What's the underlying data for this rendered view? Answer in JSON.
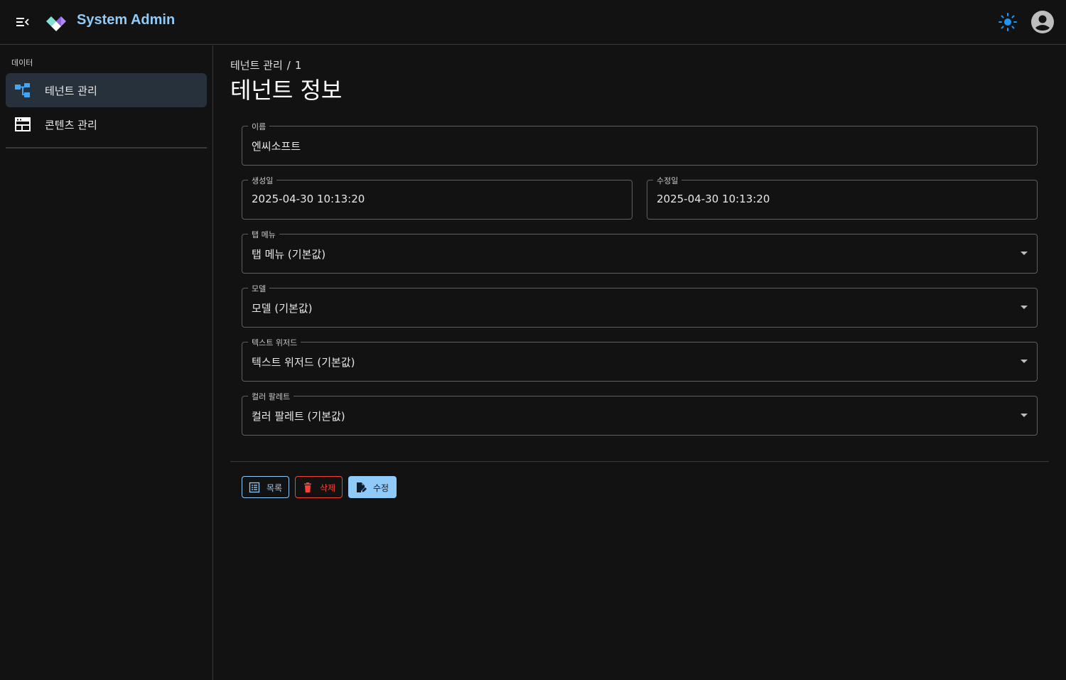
{
  "header": {
    "app_title": "System Admin",
    "icons": {
      "menu": "menu-collapse-icon",
      "logo": "logo-icon",
      "theme": "sun-icon",
      "account": "account-circle-icon"
    },
    "accent_color": "#90caf9"
  },
  "sidebar": {
    "section_label": "데이터",
    "items": [
      {
        "label": "테넌트 관리",
        "icon": "account-tree-icon",
        "active": true
      },
      {
        "label": "콘텐츠 관리",
        "icon": "web-layout-icon",
        "active": false
      }
    ]
  },
  "breadcrumb": {
    "parent": "테넌트 관리",
    "separator": "/",
    "current": "1"
  },
  "page_title": "테넌트 정보",
  "form": {
    "name": {
      "label": "이름",
      "value": "엔씨소프트"
    },
    "created": {
      "label": "생성일",
      "value": "2025-04-30 10:13:20"
    },
    "updated": {
      "label": "수정일",
      "value": "2025-04-30 10:13:20"
    },
    "tab_menu": {
      "label": "탭 메뉴",
      "value": "탭 메뉴 (기본값)"
    },
    "model": {
      "label": "모델",
      "value": "모델 (기본값)"
    },
    "text_wizard": {
      "label": "텍스트 위저드",
      "value": "텍스트 위저드 (기본값)"
    },
    "color_palette": {
      "label": "컬러 팔레트",
      "value": "컬러 팔레트 (기본값)"
    }
  },
  "actions": {
    "list_label": "목록",
    "delete_label": "삭제",
    "edit_label": "수정",
    "delete_color": "#f44336"
  }
}
